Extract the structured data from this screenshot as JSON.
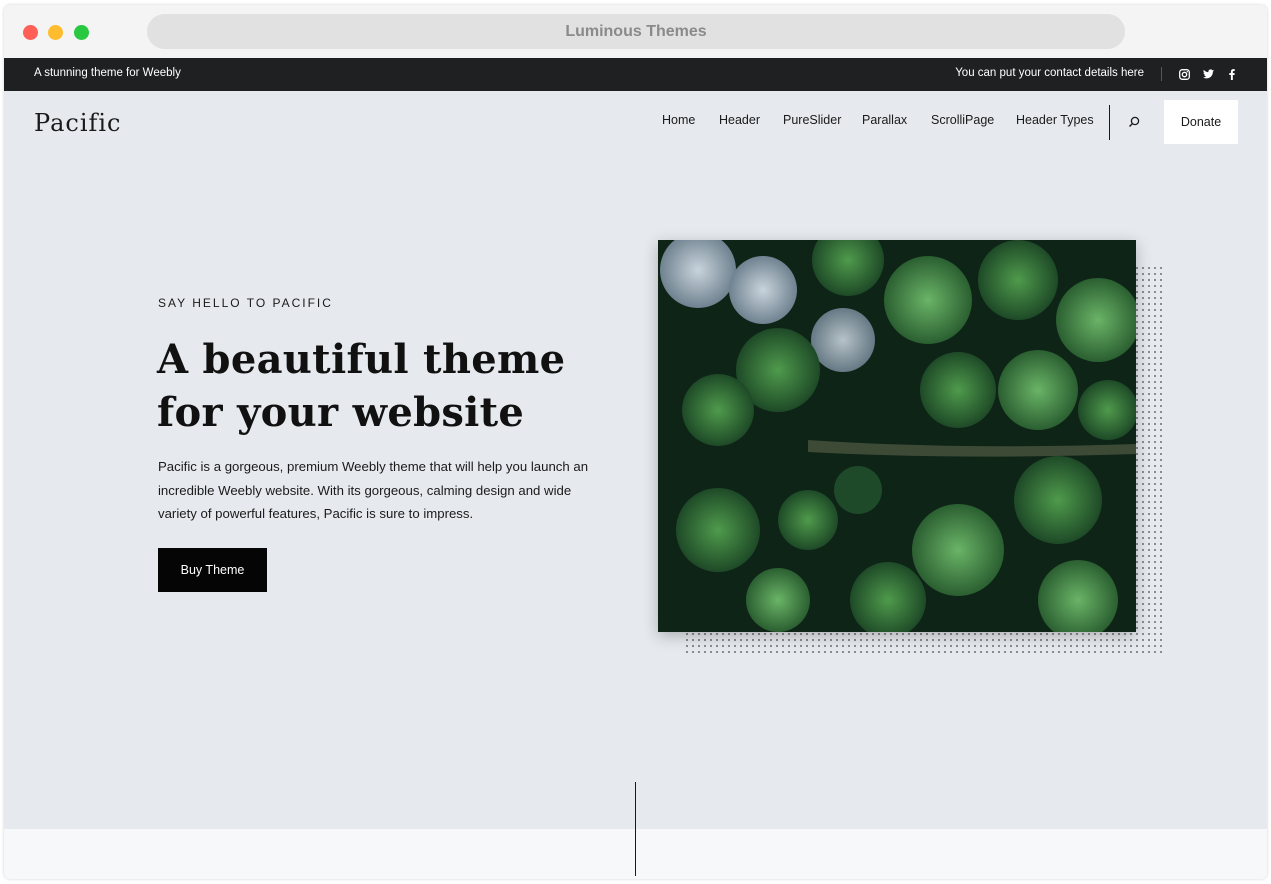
{
  "browser": {
    "title": "Luminous Themes"
  },
  "topbar": {
    "tagline": "A stunning theme for Weebly",
    "contact": "You can put your contact details here",
    "social": [
      "instagram-icon",
      "twitter-icon",
      "facebook-icon"
    ]
  },
  "nav": {
    "logo": "Pacific",
    "items": [
      {
        "label": "Home"
      },
      {
        "label": "Header"
      },
      {
        "label": "PureSlider"
      },
      {
        "label": "Parallax"
      },
      {
        "label": "ScrolliPage"
      },
      {
        "label": "Header Types"
      }
    ],
    "donate_label": "Donate"
  },
  "hero": {
    "eyebrow": "SAY HELLO TO PACIFIC",
    "headline_line1": "A beautiful theme",
    "headline_line2": "for your website",
    "description_line1": "Pacific is a gorgeous, premium Weebly theme that will help you launch an",
    "description_line2": "incredible Weebly website. With its gorgeous, calming design and wide",
    "description_line3": "variety of powerful features, Pacific is sure to impress.",
    "button_label": "Buy Theme"
  },
  "colors": {
    "page_bg": "#e6eaee",
    "topbar_bg": "#1f2022",
    "button_bg": "#050505",
    "accent_text": "#1a1a1a"
  }
}
